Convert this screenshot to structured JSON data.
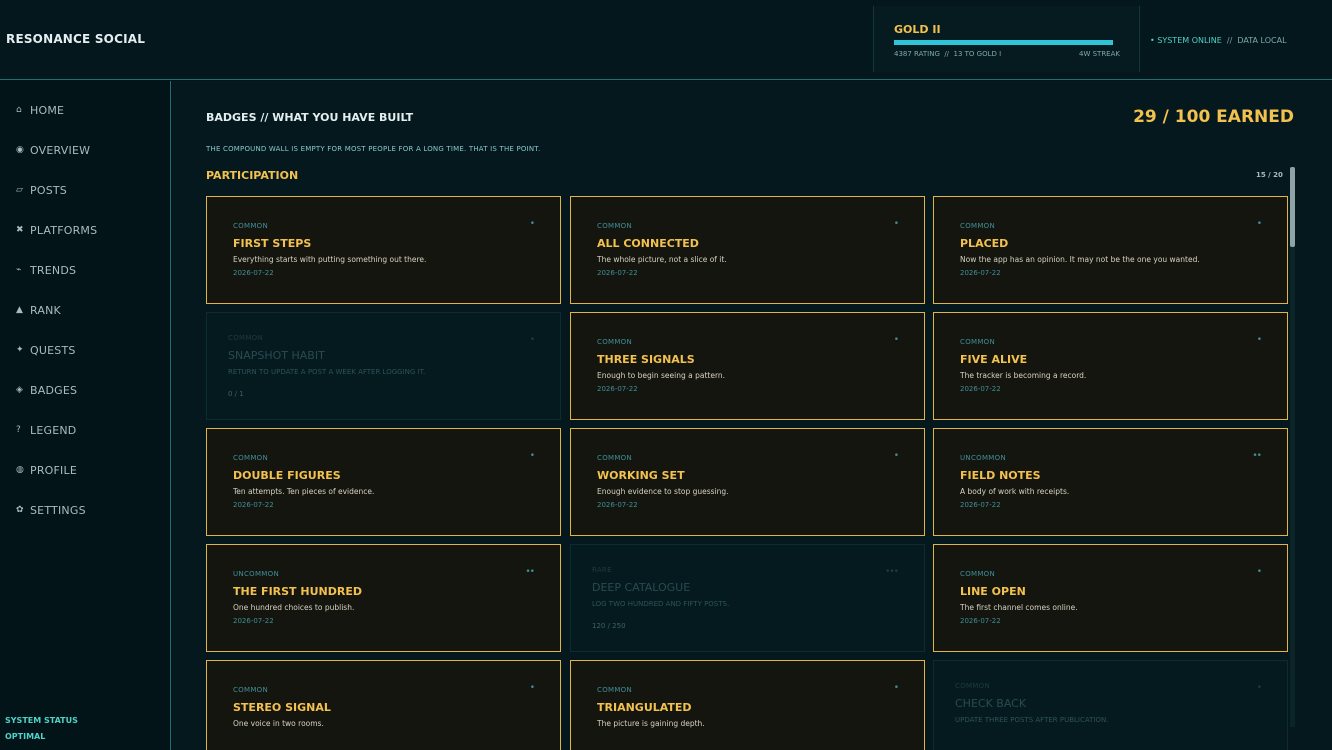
{
  "app": {
    "title": "RESONANCE SOCIAL"
  },
  "rank": {
    "tier": "GOLD II",
    "progress": 1.0,
    "rating": "4387 RATING",
    "separator": "//",
    "to_next": "13 TO GOLD I",
    "streak": "4W STREAK"
  },
  "system": {
    "online": "• SYSTEM ONLINE",
    "separator": "//",
    "data": "DATA LOCAL"
  },
  "sidebar": {
    "items": [
      {
        "icon": "⌂",
        "label": "HOME"
      },
      {
        "icon": "◉",
        "label": "OVERVIEW"
      },
      {
        "icon": "▱",
        "label": "POSTS"
      },
      {
        "icon": "✖",
        "label": "PLATFORMS"
      },
      {
        "icon": "⌁",
        "label": "TRENDS"
      },
      {
        "icon": "▲",
        "label": "RANK"
      },
      {
        "icon": "✦",
        "label": "QUESTS"
      },
      {
        "icon": "◈",
        "label": "BADGES"
      },
      {
        "icon": "?",
        "label": "LEGEND"
      },
      {
        "icon": "◍",
        "label": "PROFILE"
      },
      {
        "icon": "✿",
        "label": "SETTINGS"
      }
    ],
    "status_label": "SYSTEM STATUS",
    "status_value": "OPTIMAL"
  },
  "main": {
    "title": "BADGES // WHAT YOU HAVE BUILT",
    "earned": "29 / 100 EARNED",
    "subtitle": "THE COMPOUND WALL IS EMPTY FOR MOST PEOPLE FOR A LONG TIME. THAT IS THE POINT.",
    "section": "PARTICIPATION",
    "section_count": "15 / 20"
  },
  "badges": [
    {
      "state": "earned",
      "rarity": "COMMON",
      "dots": "•",
      "name": "FIRST STEPS",
      "desc": "Everything starts with putting something out there.",
      "date": "2026-07-22"
    },
    {
      "state": "earned",
      "rarity": "COMMON",
      "dots": "•",
      "name": "ALL CONNECTED",
      "desc": "The whole picture, not a slice of it.",
      "date": "2026-07-22"
    },
    {
      "state": "earned",
      "rarity": "COMMON",
      "dots": "•",
      "name": "PLACED",
      "desc": "Now the app has an opinion. It may not be the one you wanted.",
      "date": "2026-07-22"
    },
    {
      "state": "locked",
      "rarity": "COMMON",
      "dots": "•",
      "name": "SNAPSHOT HABIT",
      "desc": "Return to update a post a week after logging it.",
      "progress": "0 / 1"
    },
    {
      "state": "earned",
      "rarity": "COMMON",
      "dots": "•",
      "name": "THREE SIGNALS",
      "desc": "Enough to begin seeing a pattern.",
      "date": "2026-07-22"
    },
    {
      "state": "earned",
      "rarity": "COMMON",
      "dots": "•",
      "name": "FIVE ALIVE",
      "desc": "The tracker is becoming a record.",
      "date": "2026-07-22"
    },
    {
      "state": "earned",
      "rarity": "COMMON",
      "dots": "•",
      "name": "DOUBLE FIGURES",
      "desc": "Ten attempts. Ten pieces of evidence.",
      "date": "2026-07-22"
    },
    {
      "state": "earned",
      "rarity": "COMMON",
      "dots": "•",
      "name": "WORKING SET",
      "desc": "Enough evidence to stop guessing.",
      "date": "2026-07-22"
    },
    {
      "state": "earned",
      "rarity": "UNCOMMON",
      "dots": "••",
      "name": "FIELD NOTES",
      "desc": "A body of work with receipts.",
      "date": "2026-07-22"
    },
    {
      "state": "earned",
      "rarity": "UNCOMMON",
      "dots": "••",
      "name": "THE FIRST HUNDRED",
      "desc": "One hundred choices to publish.",
      "date": "2026-07-22"
    },
    {
      "state": "locked",
      "rarity": "RARE",
      "dots": "•••",
      "name": "DEEP CATALOGUE",
      "desc": "Log two hundred and fifty posts.",
      "progress": "120 / 250"
    },
    {
      "state": "earned",
      "rarity": "COMMON",
      "dots": "•",
      "name": "LINE OPEN",
      "desc": "The first channel comes online.",
      "date": "2026-07-22"
    },
    {
      "state": "earned",
      "rarity": "COMMON",
      "dots": "•",
      "name": "STEREO SIGNAL",
      "desc": "One voice in two rooms.",
      "date": ""
    },
    {
      "state": "earned",
      "rarity": "COMMON",
      "dots": "•",
      "name": "TRIANGULATED",
      "desc": "The picture is gaining depth.",
      "date": ""
    },
    {
      "state": "locked",
      "rarity": "COMMON",
      "dots": "•",
      "name": "CHECK BACK",
      "desc": "Update three posts after publication.",
      "progress": ""
    }
  ],
  "colors": {
    "accent": "#f2c14e",
    "cyan": "#2fc4d8",
    "border": "#1d6f78"
  }
}
